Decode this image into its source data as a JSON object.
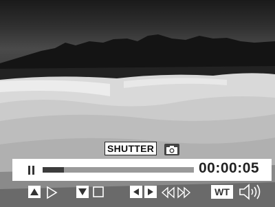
{
  "playback": {
    "shutter_label": "SHUTTER",
    "time_display": "00:00:05",
    "progress": 0.14,
    "wt_label": "WT"
  },
  "icons": [
    "pause-icon",
    "camera-icon",
    "up-icon",
    "play-icon",
    "down-icon",
    "stop-icon",
    "left-icon",
    "right-icon",
    "rewind-icon",
    "fast-forward-icon",
    "speaker-icon"
  ],
  "colors": {
    "bar_bg": "#ffffff",
    "track": "#9a9a9a",
    "track_fill": "#3c3c3c"
  }
}
